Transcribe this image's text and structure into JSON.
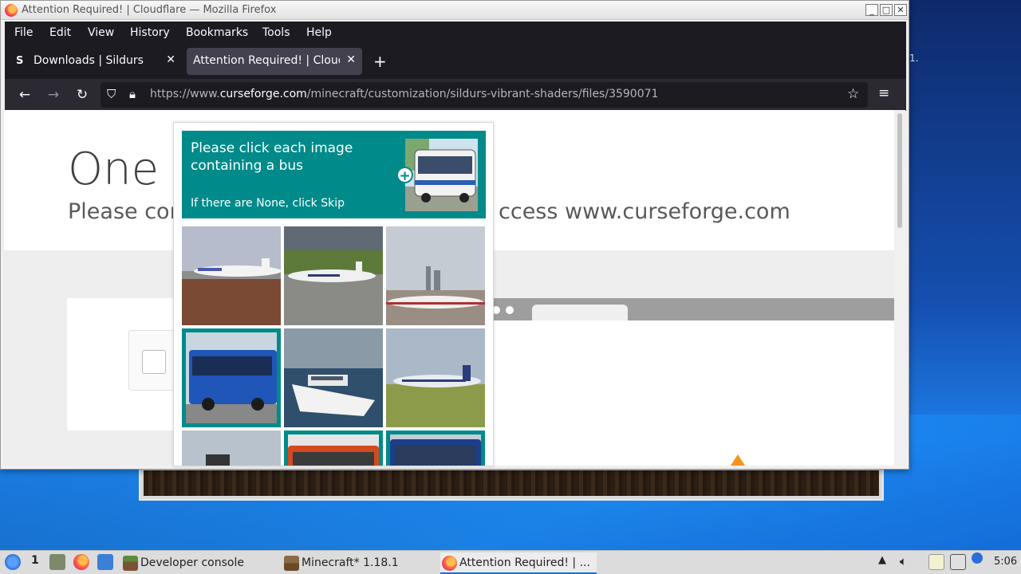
{
  "window": {
    "title": "Attention Required! | Cloudflare — Mozilla Firefox"
  },
  "menubar": {
    "items": [
      "File",
      "Edit",
      "View",
      "History",
      "Bookmarks",
      "Tools",
      "Help"
    ]
  },
  "tabs": [
    {
      "favicon": "S",
      "label": "Downloads | Sildurs Shad",
      "active": false
    },
    {
      "favicon": "",
      "label": "Attention Required! | Cloudfl",
      "active": true
    }
  ],
  "navbar": {
    "url_prefix": "https://www.",
    "url_domain": "curseforge.com",
    "url_path": "/minecraft/customization/sildurs-vibrant-shaders/files/3590071"
  },
  "page": {
    "heading": "One m",
    "subheading_left": "Please con",
    "subheading_right": "ccess www.curseforge.com"
  },
  "captcha": {
    "prompt": "Please click each image containing a bus",
    "skip_hint": "If there are None, click Skip",
    "tiles": [
      {
        "content": "airplane",
        "selected": false
      },
      {
        "content": "airplane",
        "selected": false
      },
      {
        "content": "airplane",
        "selected": false
      },
      {
        "content": "bus",
        "selected": true
      },
      {
        "content": "boat",
        "selected": false
      },
      {
        "content": "airplane",
        "selected": false
      },
      {
        "content": "unknown",
        "selected": false
      },
      {
        "content": "bus",
        "selected": true
      },
      {
        "content": "bus",
        "selected": true
      }
    ],
    "accent_color": "#008a8a"
  },
  "desktop": {
    "edge_text": "1."
  },
  "taskbar": {
    "workspace": "1",
    "tasks": [
      {
        "label": "Developer console",
        "icon": "minecraft-block-icon"
      },
      {
        "label": "Minecraft* 1.18.1",
        "icon": "minecraft-block-icon"
      },
      {
        "label": "Attention Required! | ...",
        "icon": "firefox-icon",
        "active": true
      }
    ],
    "clock": "5:06"
  }
}
